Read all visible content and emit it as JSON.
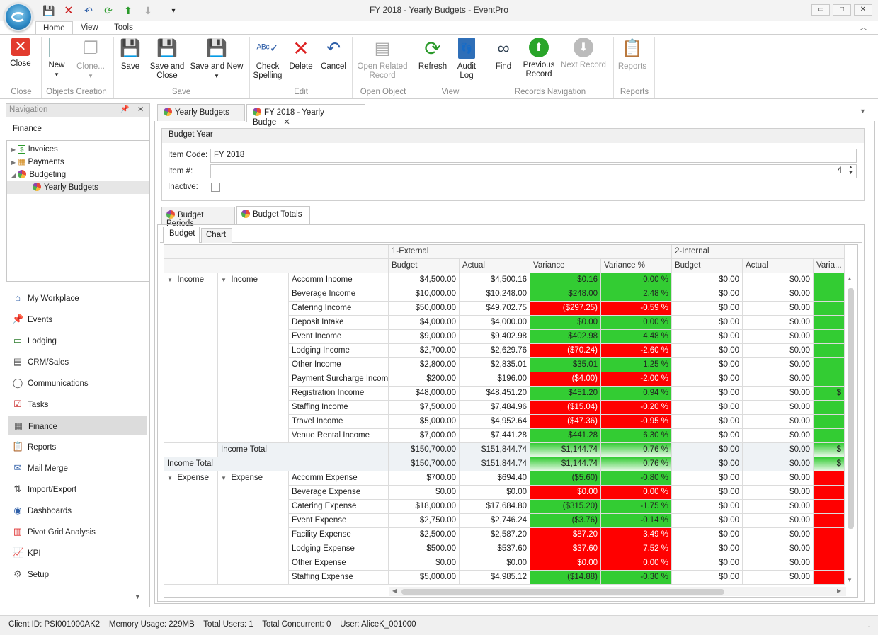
{
  "window": {
    "title": "FY 2018 - Yearly Budgets - EventPro",
    "minimize": "▭",
    "maximize": "□",
    "close": "✕"
  },
  "ribbon_tabs": [
    "Home",
    "View",
    "Tools"
  ],
  "ribbon": {
    "close": "Close",
    "new": "New",
    "clone": "Clone...",
    "save": "Save",
    "save_close": [
      "Save and",
      "Close"
    ],
    "save_new": "Save and New",
    "check_spelling": [
      "Check",
      "Spelling"
    ],
    "delete": "Delete",
    "cancel": "Cancel",
    "open_related": [
      "Open Related",
      "Record"
    ],
    "refresh": "Refresh",
    "audit_log": [
      "Audit",
      "Log"
    ],
    "find": "Find",
    "previous_record": [
      "Previous",
      "Record"
    ],
    "next_record": "Next Record",
    "reports": "Reports",
    "groups": [
      "Close",
      "Objects Creation",
      "Save",
      "Edit",
      "Open Object",
      "View",
      "Records Navigation",
      "Reports"
    ]
  },
  "nav": {
    "header": "Navigation",
    "section": "Finance",
    "tree": [
      "Invoices",
      "Payments",
      "Budgeting",
      "Yearly Budgets"
    ],
    "items": [
      "My Workplace",
      "Events",
      "Lodging",
      "CRM/Sales",
      "Communications",
      "Tasks",
      "Finance",
      "Reports",
      "Mail Merge",
      "Import/Export",
      "Dashboards",
      "Pivot Grid Analysis",
      "KPI",
      "Setup"
    ]
  },
  "doc_tabs": [
    "Yearly Budgets",
    "FY 2018 - Yearly Budge"
  ],
  "budget_year": {
    "header": "Budget Year",
    "item_code_label": "Item Code:",
    "item_code": "FY 2018",
    "item_num_label": "Item #:",
    "item_num": "4",
    "inactive_label": "Inactive:"
  },
  "subtabs": [
    "Budget Periods",
    "Budget Totals"
  ],
  "view_tabs": [
    "Budget",
    "Chart"
  ],
  "grid": {
    "groups": [
      "1-External",
      "2-Internal"
    ],
    "columns": [
      "Budget",
      "Actual",
      "Variance",
      "Variance %",
      "Budget",
      "Actual",
      "Varia..."
    ],
    "income_label": "Income",
    "expense_label": "Expense",
    "income_total_label": "Income Total",
    "rows": [
      {
        "name": "Accomm Income",
        "budget": "$4,500.00",
        "actual": "$4,500.16",
        "variance": "$0.16",
        "pct": "0.00 %",
        "status": "green",
        "ib": "$0.00",
        "ia": "$0.00",
        "iv": "",
        "is": "green"
      },
      {
        "name": "Beverage Income",
        "budget": "$10,000.00",
        "actual": "$10,248.00",
        "variance": "$248.00",
        "pct": "2.48 %",
        "status": "green",
        "ib": "$0.00",
        "ia": "$0.00",
        "iv": "",
        "is": "green"
      },
      {
        "name": "Catering Income",
        "budget": "$50,000.00",
        "actual": "$49,702.75",
        "variance": "($297.25)",
        "pct": "-0.59 %",
        "status": "red",
        "ib": "$0.00",
        "ia": "$0.00",
        "iv": "",
        "is": "green"
      },
      {
        "name": "Deposit Intake",
        "budget": "$4,000.00",
        "actual": "$4,000.00",
        "variance": "$0.00",
        "pct": "0.00 %",
        "status": "green",
        "ib": "$0.00",
        "ia": "$0.00",
        "iv": "",
        "is": "green"
      },
      {
        "name": "Event Income",
        "budget": "$9,000.00",
        "actual": "$9,402.98",
        "variance": "$402.98",
        "pct": "4.48 %",
        "status": "green",
        "ib": "$0.00",
        "ia": "$0.00",
        "iv": "",
        "is": "green"
      },
      {
        "name": "Lodging Income",
        "budget": "$2,700.00",
        "actual": "$2,629.76",
        "variance": "($70.24)",
        "pct": "-2.60 %",
        "status": "red",
        "ib": "$0.00",
        "ia": "$0.00",
        "iv": "",
        "is": "green"
      },
      {
        "name": "Other Income",
        "budget": "$2,800.00",
        "actual": "$2,835.01",
        "variance": "$35.01",
        "pct": "1.25 %",
        "status": "green",
        "ib": "$0.00",
        "ia": "$0.00",
        "iv": "",
        "is": "green"
      },
      {
        "name": "Payment Surcharge Income",
        "budget": "$200.00",
        "actual": "$196.00",
        "variance": "($4.00)",
        "pct": "-2.00 %",
        "status": "red",
        "ib": "$0.00",
        "ia": "$0.00",
        "iv": "",
        "is": "green"
      },
      {
        "name": "Registration Income",
        "budget": "$48,000.00",
        "actual": "$48,451.20",
        "variance": "$451.20",
        "pct": "0.94 %",
        "status": "green",
        "ib": "$0.00",
        "ia": "$0.00",
        "iv": "$",
        "is": "green"
      },
      {
        "name": "Staffing Income",
        "budget": "$7,500.00",
        "actual": "$7,484.96",
        "variance": "($15.04)",
        "pct": "-0.20 %",
        "status": "red",
        "ib": "$0.00",
        "ia": "$0.00",
        "iv": "",
        "is": "green"
      },
      {
        "name": "Travel Income",
        "budget": "$5,000.00",
        "actual": "$4,952.64",
        "variance": "($47.36)",
        "pct": "-0.95 %",
        "status": "red",
        "ib": "$0.00",
        "ia": "$0.00",
        "iv": "",
        "is": "green"
      },
      {
        "name": "Venue Rental Income",
        "budget": "$7,000.00",
        "actual": "$7,441.28",
        "variance": "$441.28",
        "pct": "6.30 %",
        "status": "green",
        "ib": "$0.00",
        "ia": "$0.00",
        "iv": "",
        "is": "green"
      }
    ],
    "subtotal": {
      "budget": "$150,700.00",
      "actual": "$151,844.74",
      "variance": "$1,144.74",
      "pct": "0.76 %",
      "ib": "$0.00",
      "ia": "$0.00",
      "iv": "$"
    },
    "total": {
      "budget": "$150,700.00",
      "actual": "$151,844.74",
      "variance": "$1,144.74",
      "pct": "0.76 %",
      "ib": "$0.00",
      "ia": "$0.00",
      "iv": "$"
    },
    "expense_rows": [
      {
        "name": "Accomm Expense",
        "budget": "$700.00",
        "actual": "$694.40",
        "variance": "($5.60)",
        "pct": "-0.80 %",
        "status": "green",
        "ib": "$0.00",
        "ia": "$0.00",
        "iv": "",
        "is": "red"
      },
      {
        "name": "Beverage Expense",
        "budget": "$0.00",
        "actual": "$0.00",
        "variance": "$0.00",
        "pct": "0.00 %",
        "status": "red",
        "ib": "$0.00",
        "ia": "$0.00",
        "iv": "",
        "is": "red"
      },
      {
        "name": "Catering Expense",
        "budget": "$18,000.00",
        "actual": "$17,684.80",
        "variance": "($315.20)",
        "pct": "-1.75 %",
        "status": "green",
        "ib": "$0.00",
        "ia": "$0.00",
        "iv": "",
        "is": "red"
      },
      {
        "name": "Event Expense",
        "budget": "$2,750.00",
        "actual": "$2,746.24",
        "variance": "($3.76)",
        "pct": "-0.14 %",
        "status": "green",
        "ib": "$0.00",
        "ia": "$0.00",
        "iv": "",
        "is": "red"
      },
      {
        "name": "Facility Expense",
        "budget": "$2,500.00",
        "actual": "$2,587.20",
        "variance": "$87.20",
        "pct": "3.49 %",
        "status": "red",
        "ib": "$0.00",
        "ia": "$0.00",
        "iv": "",
        "is": "red"
      },
      {
        "name": "Lodging Expense",
        "budget": "$500.00",
        "actual": "$537.60",
        "variance": "$37.60",
        "pct": "7.52 %",
        "status": "red",
        "ib": "$0.00",
        "ia": "$0.00",
        "iv": "",
        "is": "red"
      },
      {
        "name": "Other Expense",
        "budget": "$0.00",
        "actual": "$0.00",
        "variance": "$0.00",
        "pct": "0.00 %",
        "status": "red",
        "ib": "$0.00",
        "ia": "$0.00",
        "iv": "",
        "is": "red"
      },
      {
        "name": "Staffing Expense",
        "budget": "$5,000.00",
        "actual": "$4,985.12",
        "variance": "($14.88)",
        "pct": "-0.30 %",
        "status": "green",
        "ib": "$0.00",
        "ia": "$0.00",
        "iv": "",
        "is": "red"
      }
    ]
  },
  "status": {
    "client_id": "Client ID: PSI001000AK2",
    "memory": "Memory Usage: 229MB",
    "users": "Total Users: 1",
    "concurrent": "Total Concurrent: 0",
    "user": "User: AliceK_001000"
  },
  "colors": {
    "green": "#33cc33",
    "red": "#ff0000",
    "accent": "#2c88c4"
  }
}
